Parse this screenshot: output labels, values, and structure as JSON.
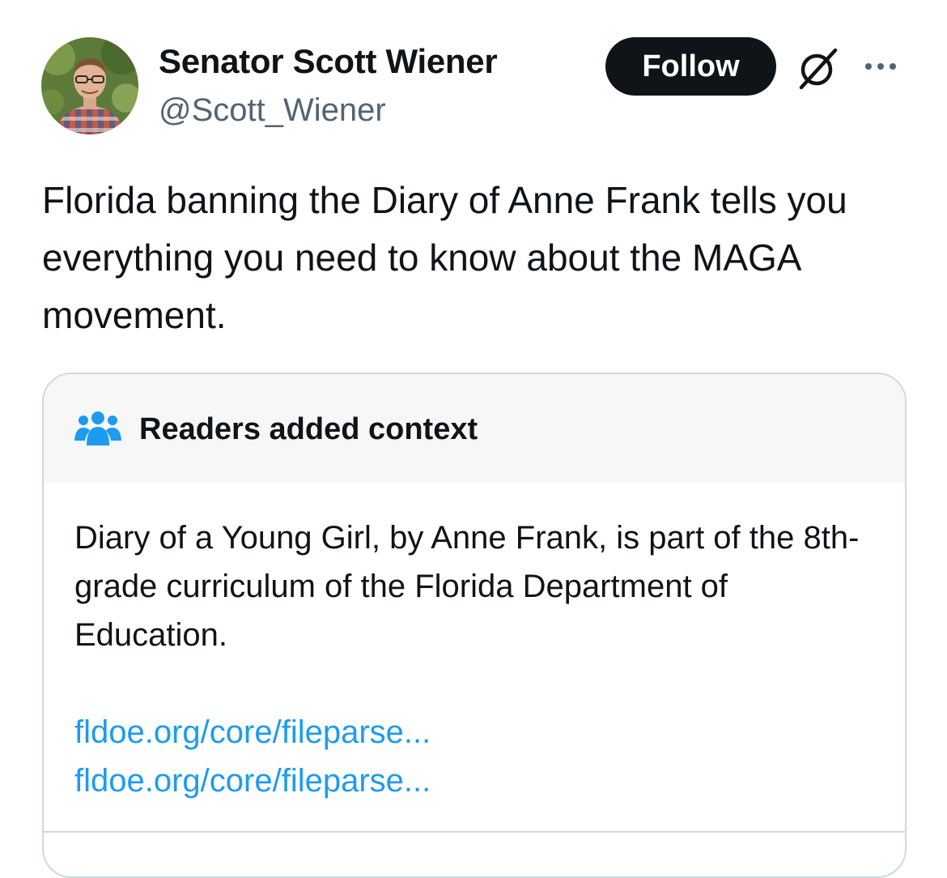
{
  "author": {
    "display_name": "Senator Scott Wiener",
    "handle": "@Scott_Wiener",
    "avatar_icon": "profile-photo"
  },
  "actions": {
    "follow_label": "Follow",
    "grok_icon": "grok-slash-icon",
    "more_icon": "more-horizontal-icon"
  },
  "tweet": {
    "text": "Florida banning the Diary of Anne Frank tells you everything you need to know about the MAGA movement."
  },
  "community_note": {
    "icon": "readers-group-icon",
    "title": "Readers added context",
    "body": "Diary of a Young Girl, by Anne Frank, is part of the 8th-grade curriculum of the Florida Department of Education.",
    "links": [
      "fldoe.org/core/fileparse...",
      "fldoe.org/core/fileparse..."
    ]
  },
  "colors": {
    "text_primary": "#0f1419",
    "text_secondary": "#536471",
    "link": "#1d9bf0",
    "border": "#cfd9de",
    "note_header_bg": "#f7f7f7",
    "follow_bg": "#0f1419"
  }
}
